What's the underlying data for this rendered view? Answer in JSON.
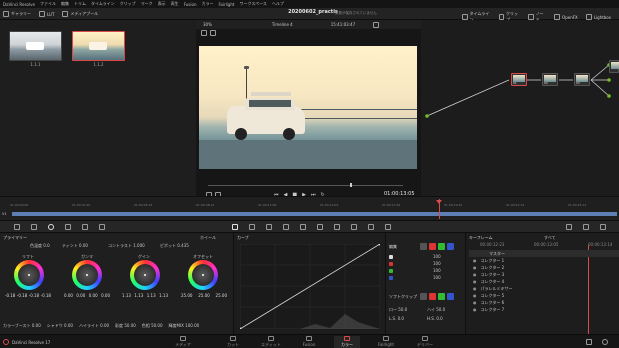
{
  "menubar": {
    "items": [
      "DaVinci Resolve",
      "ファイル",
      "編集",
      "トリム",
      "タイムライン",
      "クリップ",
      "マーク",
      "表示",
      "再生",
      "Fusion",
      "カラー",
      "Fairlight",
      "ワークスペース",
      "ヘルプ"
    ]
  },
  "toolbar": {
    "left": [
      "ギャラリー",
      "LUT",
      "メディアプール"
    ],
    "zoom": "30%",
    "timeline_name": "Timeline 4",
    "timecode": "15:41:03:47",
    "project_title": "20200602_practis",
    "project_subtitle": "変更が保存されていません",
    "right": [
      "タイムライン",
      "クリップ",
      "ノード",
      "OpenFX",
      "Lightbox"
    ]
  },
  "gallery": {
    "clips": [
      {
        "label": "1.1.1"
      },
      {
        "label": "1.1.2"
      }
    ]
  },
  "viewer": {
    "timecode": "01:00:13:05"
  },
  "nodes": {
    "labels": [
      "01",
      "02",
      "03",
      "04"
    ]
  },
  "timeline": {
    "left_label": "V1",
    "ruler": [
      "01:00:00:00",
      "01:00:02:20",
      "01:00:05:16",
      "01:00:08:12",
      "01:00:11:08",
      "01:00:14:04",
      "01:00:17:00",
      "01:00:19:20",
      "01:00:22:16",
      "01:00:25:12",
      "01:00:28:08",
      "01:00:31:04",
      "01:00:34:00",
      "01:00:36:20"
    ]
  },
  "wheels": {
    "title": "プライマリー",
    "mode": "ホイール",
    "top_params": [
      {
        "label": "コントラスト",
        "value": "1.000"
      },
      {
        "label": "ピボット",
        "value": "0.435"
      },
      {
        "label": "彩度",
        "value": "50.00"
      },
      {
        "label": "色相",
        "value": "50.00"
      },
      {
        "label": "輝度MIX",
        "value": "100.00"
      },
      {
        "label": "ハイライト",
        "value": "0.00"
      },
      {
        "label": "シャドウ",
        "value": "0.00"
      },
      {
        "label": "ミッドトーン",
        "value": "0.00"
      },
      {
        "label": "色温度",
        "value": "0.0"
      },
      {
        "label": "ティント",
        "value": "0.00"
      }
    ],
    "items": [
      {
        "name": "リフト",
        "values": [
          "-0.18",
          "-0.18",
          "-0.18",
          "-0.18"
        ]
      },
      {
        "name": "ガンマ",
        "values": [
          "0.00",
          "0.00",
          "0.00",
          "0.00"
        ]
      },
      {
        "name": "ゲイン",
        "values": [
          "1.13",
          "1.13",
          "1.13",
          "1.13"
        ]
      },
      {
        "name": "オフセット",
        "values": [
          "25.00",
          "25.00",
          "25.00",
          ""
        ]
      }
    ],
    "bottom_params": [
      {
        "label": "カラーブースト",
        "value": "0.00"
      },
      {
        "label": "シャドウ",
        "value": "0.00"
      },
      {
        "label": "ハイライト",
        "value": "0.00"
      },
      {
        "label": "彩度",
        "value": "50.00"
      },
      {
        "label": "色相",
        "value": "50.00"
      },
      {
        "label": "輝度MIX",
        "value": "100.00"
      }
    ]
  },
  "curves": {
    "title": "カーブ"
  },
  "edit_panel": {
    "title": "編集",
    "rows": [
      {
        "value": "100"
      },
      {
        "value": "100"
      },
      {
        "value": "100"
      },
      {
        "value": "100"
      }
    ],
    "soft_clip_label": "ソフトクリップ",
    "soft_params": [
      {
        "label": "ロー",
        "value": "50.0"
      },
      {
        "label": "ハイ",
        "value": "50.0"
      },
      {
        "label": "L.S.",
        "value": "0.0"
      },
      {
        "label": "H.S.",
        "value": "0.0"
      }
    ]
  },
  "keyframes": {
    "title": "キーフレーム",
    "filter": "すべて",
    "times": [
      "00:00:12:23",
      "00:00:13:05",
      "00:00:13:14"
    ],
    "tracks": [
      "マスター",
      "コレクター 1",
      "コレクター 2",
      "コレクター 3",
      "コレクター 4",
      "パラレルミキサー",
      "コレクター 5",
      "コレクター 6",
      "コレクター 7"
    ]
  },
  "pagenav": {
    "app": "DaVinci Resolve 17",
    "items": [
      "メディア",
      "カット",
      "エディット",
      "Fusion",
      "カラー",
      "Fairlight",
      "デリバー"
    ],
    "active": "カラー"
  },
  "colors": {
    "accent": "#d94a4a",
    "timeline_track": "#5d7fb3"
  }
}
